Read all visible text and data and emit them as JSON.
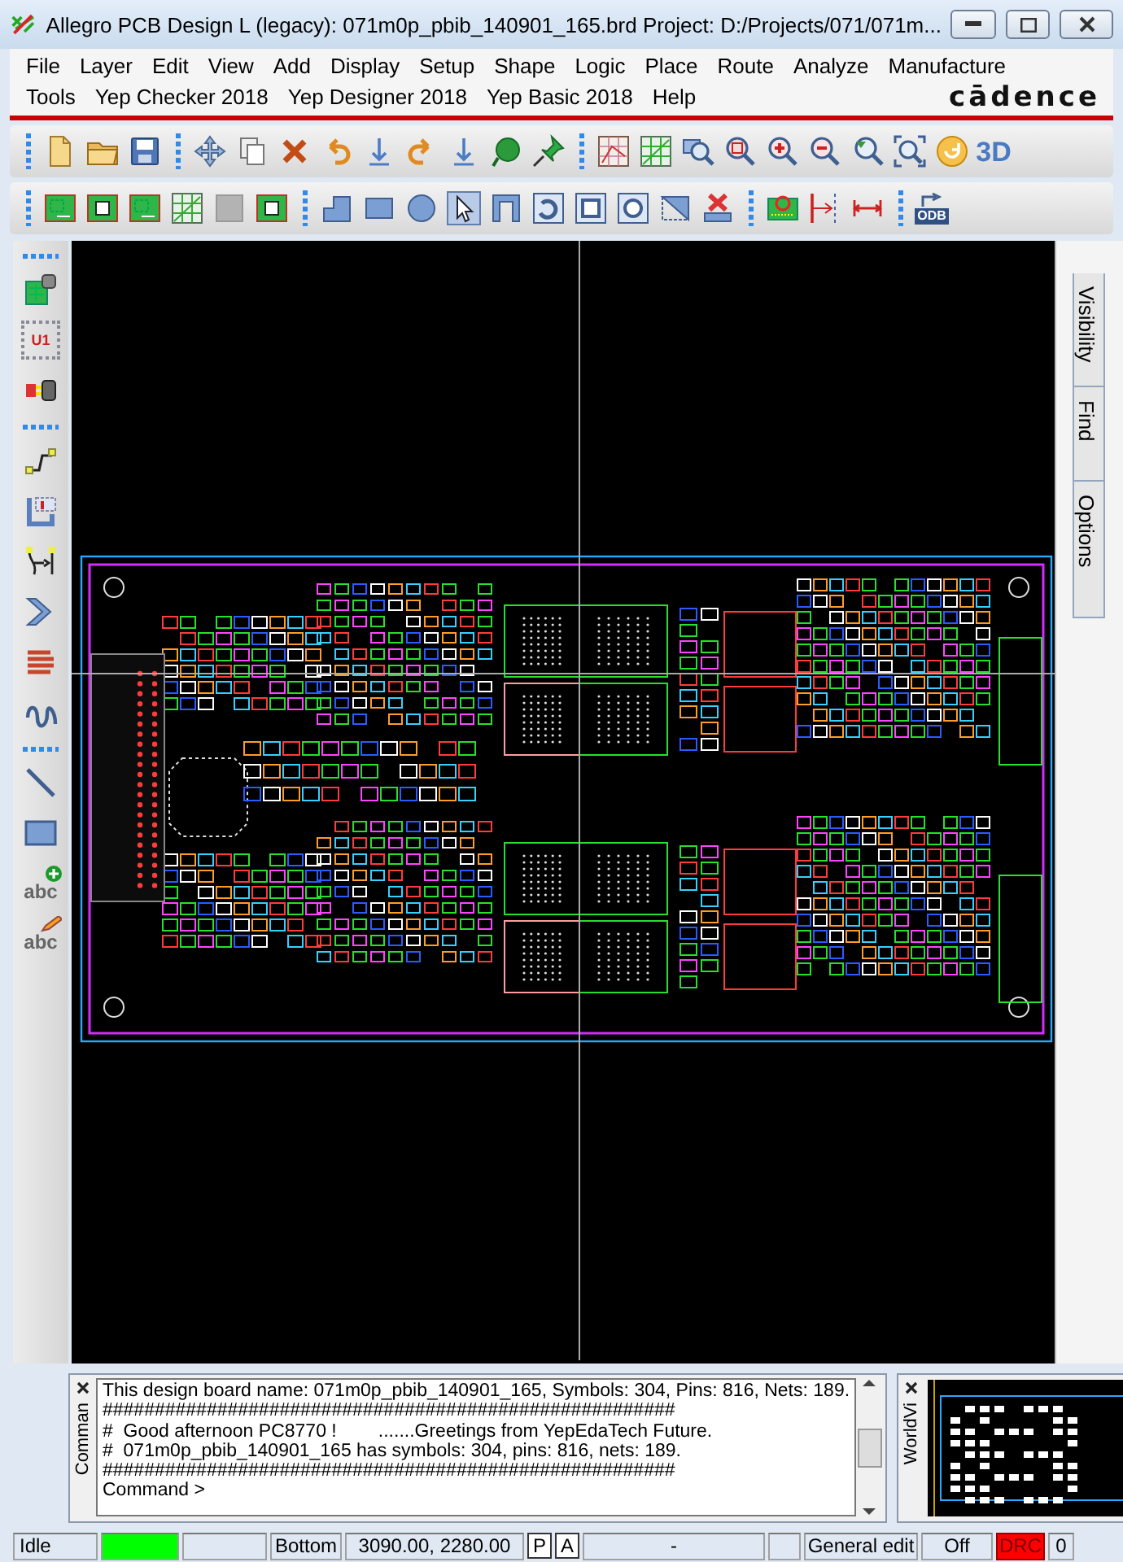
{
  "window": {
    "title": "Allegro PCB Design L (legacy): 071m0p_pbib_140901_165.brd  Project: D:/Projects/071/071m..."
  },
  "menu_rows": [
    [
      {
        "label": "File"
      },
      {
        "label": "Layer"
      },
      {
        "label": "Edit"
      },
      {
        "label": "View"
      },
      {
        "label": "Add"
      },
      {
        "label": "Display"
      },
      {
        "label": "Setup"
      },
      {
        "label": "Shape"
      },
      {
        "label": "Logic"
      },
      {
        "label": "Place"
      },
      {
        "label": "Route"
      },
      {
        "label": "Analyze"
      },
      {
        "label": "Manufacture"
      }
    ],
    [
      {
        "label": "Tools"
      },
      {
        "label": "Yep Checker 2018"
      },
      {
        "label": "Yep Designer 2018"
      },
      {
        "label": "Yep Basic 2018"
      },
      {
        "label": "Help"
      }
    ]
  ],
  "logo": "cādence",
  "toolbar": {
    "view_3d_label": "3D"
  },
  "toolbar2": {
    "odb_label": "ODB"
  },
  "left_toolbar": {
    "chip_label": "U1",
    "add_text_label": "abc",
    "edit_text_label": "abc"
  },
  "side_tabs": [
    {
      "label": "Visibility"
    },
    {
      "label": "Find"
    },
    {
      "label": "Options"
    }
  ],
  "console": {
    "title": "Comman",
    "lines": [
      "This design board name: 071m0p_pbib_140901_165, Symbols: 304, Pins: 816, Nets: 189.",
      "#######################################################",
      "#  Good afternoon PC8770 !        .......Greetings from YepEdaTech Future.",
      "#  071m0p_pbib_140901_165 has symbols: 304, pins: 816, nets: 189.",
      "#######################################################"
    ],
    "prompt": "Command >"
  },
  "world_view": {
    "title": "WorldVi"
  },
  "status_bar": [
    {
      "kind": "text",
      "text": "Idle"
    },
    {
      "kind": "indicator",
      "color": "#00ff00"
    },
    {
      "kind": "blank"
    },
    {
      "kind": "text",
      "text": "Bottom"
    },
    {
      "kind": "text",
      "text": "3090.00, 2280.00"
    },
    {
      "kind": "button",
      "text": "P"
    },
    {
      "kind": "button",
      "text": "A"
    },
    {
      "kind": "text",
      "text": "-"
    },
    {
      "kind": "blank"
    },
    {
      "kind": "text",
      "text": "General edit"
    },
    {
      "kind": "text",
      "text": "Off"
    },
    {
      "kind": "flag",
      "text": "DRC",
      "color": "#ff0000"
    },
    {
      "kind": "text",
      "text": "0"
    }
  ]
}
